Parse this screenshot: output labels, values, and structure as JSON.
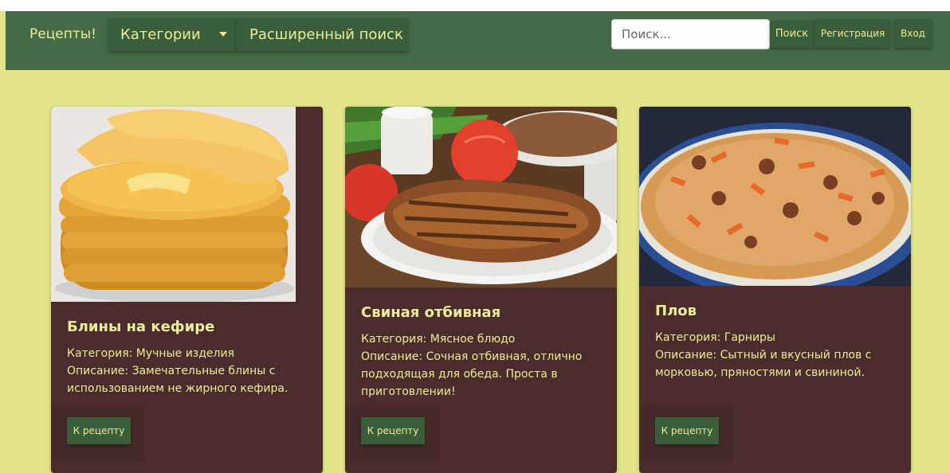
{
  "navbar": {
    "brand": "Рецепты!",
    "categories_label": "Категории",
    "advanced_search_label": "Расширенный поиск",
    "search_placeholder": "Поиск...",
    "search_button": "Поиск",
    "register_button": "Регистрация",
    "login_button": "Вход"
  },
  "recipes": [
    {
      "title": "Блины на кефире",
      "category": "Категория: Мучные изделия",
      "description": "Описание: Замечательные блины с использованием не жирного кефира.",
      "button": "К рецепту",
      "image": "pancakes"
    },
    {
      "title": "Свиная отбивная",
      "category": "Категория: Мясное блюдо",
      "description": "Описание: Сочная отбивная, отлично подходящая для обеда. Проста в приготовлении!",
      "button": "К рецепту",
      "image": "pork-chop"
    },
    {
      "title": "Плов",
      "category": "Категория: Гарниры",
      "description": "Описание: Сытный и вкусный плов с морковью, пряностями и свининой.",
      "button": "К рецепту",
      "image": "pilaf"
    }
  ],
  "colors": {
    "page_background": "#e1e587",
    "navbar": "#456b46",
    "button": "#3a5d3b",
    "card": "#4a2c2c",
    "text_accent": "#ecec9a"
  }
}
